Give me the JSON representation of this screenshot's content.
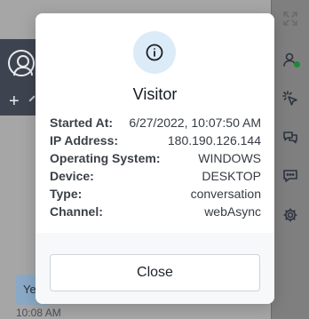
{
  "background": {
    "message_text": "Ye",
    "message_time": "10:08 AM"
  },
  "rail_icons": [
    "expand-icon",
    "user-online-icon",
    "cursor-click-icon",
    "chats-icon",
    "message-icon",
    "gear-icon"
  ],
  "modal": {
    "icon": "info-icon",
    "title": "Visitor",
    "details": [
      {
        "label": "Started At:",
        "value": "6/27/2022, 10:07:50 AM"
      },
      {
        "label": "IP Address:",
        "value": "180.190.126.144"
      },
      {
        "label": "Operating System:",
        "value": "WINDOWS"
      },
      {
        "label": "Device:",
        "value": "DESKTOP"
      },
      {
        "label": "Type:",
        "value": "conversation"
      },
      {
        "label": "Channel:",
        "value": "webAsync"
      }
    ],
    "close_label": "Close"
  },
  "colors": {
    "accent_circle": "#dcebf8",
    "overlay": "#8c8c8c",
    "online_status": "#1c8a3a"
  }
}
